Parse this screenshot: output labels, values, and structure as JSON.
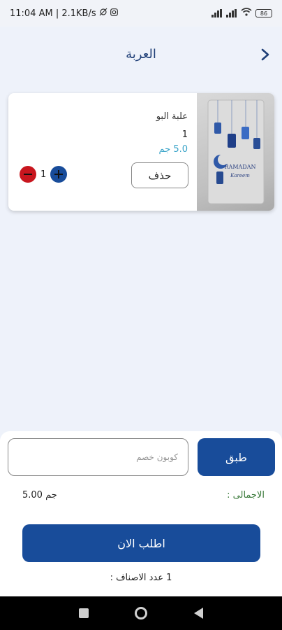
{
  "status_bar": {
    "time_info": "11:04 AM | 2.1KB/s",
    "battery": "86"
  },
  "header": {
    "title": "العربة"
  },
  "cart": {
    "items": [
      {
        "name": "علبة البو",
        "quantity_line": "1",
        "price": "5.0 جم",
        "delete_label": "حذف",
        "stepper_value": "1",
        "image_icon": "ramadan-box-image"
      }
    ]
  },
  "checkout": {
    "coupon_placeholder": "كوبون خصم",
    "apply_label": "طبق",
    "total_label": "الاجمالى :",
    "total_value": "5.00 جم",
    "order_label": "اطلب الان",
    "items_count": "1 عدد الاصناف :"
  },
  "colors": {
    "primary": "#184c9a",
    "danger": "#c8161e",
    "price": "#38a3c8",
    "total_label": "#3a7a3a"
  }
}
